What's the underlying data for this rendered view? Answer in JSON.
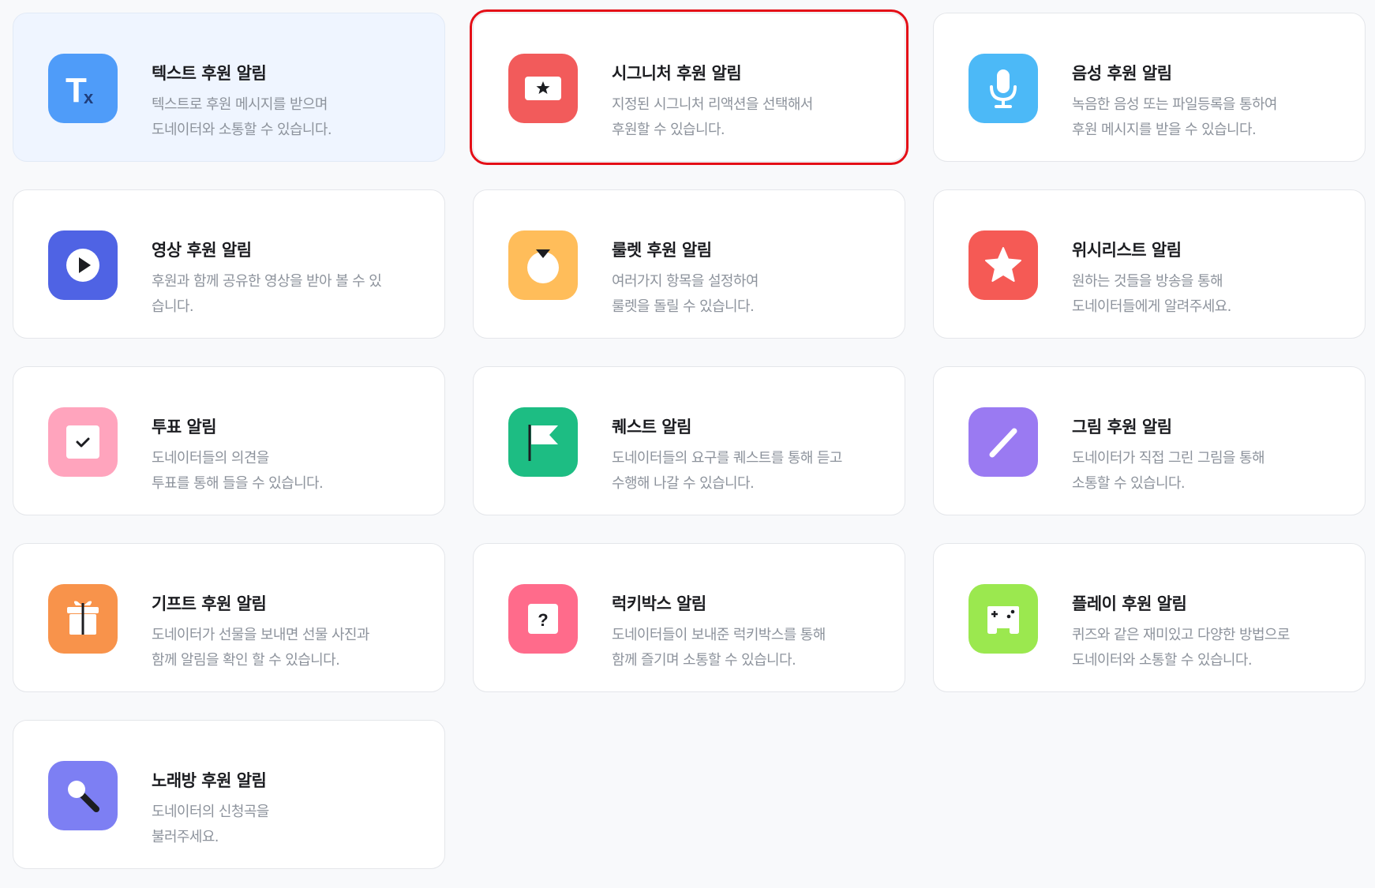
{
  "cards": [
    {
      "title": "텍스트 후원 알림",
      "desc1": "텍스트로 후원 메시지를 받으며",
      "desc2": "도네이터와 소통할 수 있습니다.",
      "icon": "text-icon",
      "color": "#4f9cf9",
      "active": true
    },
    {
      "title": "시그니처 후원 알림",
      "desc1": "지정된 시그니처 리액션을 선택해서",
      "desc2": "후원할 수 있습니다.",
      "icon": "signature-card-icon",
      "color": "#f25b5b",
      "highlighted": true
    },
    {
      "title": "음성 후원 알림",
      "desc1": "녹음한 음성 또는 파일등록을 통하여",
      "desc2": "후원 메시지를 받을 수 있습니다.",
      "icon": "microphone-icon",
      "color": "#4cb9f7"
    },
    {
      "title": "영상 후원 알림",
      "desc1": "후원과 함께 공유한 영상을 받아 볼 수 있",
      "desc2": "습니다.",
      "icon": "play-icon",
      "color": "#4f63e4"
    },
    {
      "title": "룰렛 후원 알림",
      "desc1": "여러가지 항목을 설정하여",
      "desc2": "룰렛을 돌릴 수 있습니다.",
      "icon": "roulette-icon",
      "color": "#ffbd5a"
    },
    {
      "title": "위시리스트 알림",
      "desc1": "원하는 것들을 방송을 통해",
      "desc2": "도네이터들에게 알려주세요.",
      "icon": "star-icon",
      "color": "#f55a55"
    },
    {
      "title": "투표 알림",
      "desc1": "도네이터들의 의견을",
      "desc2": "투표를 통해 들을 수 있습니다.",
      "icon": "checkbox-icon",
      "color": "#ffa4bd"
    },
    {
      "title": "퀘스트 알림",
      "desc1": "도네이터들의 요구를 퀘스트를 통해 듣고",
      "desc2": "수행해 나갈 수 있습니다.",
      "icon": "flag-icon",
      "color": "#1dbd83"
    },
    {
      "title": "그림 후원 알림",
      "desc1": "도네이터가 직접 그린 그림을 통해",
      "desc2": "소통할 수 있습니다.",
      "icon": "pencil-icon",
      "color": "#9a7af2"
    },
    {
      "title": "기프트 후원 알림",
      "desc1": "도네이터가 선물을 보내면 선물 사진과",
      "desc2": "함께 알림을 확인 할 수 있습니다.",
      "icon": "gift-icon",
      "color": "#f8934b"
    },
    {
      "title": "럭키박스 알림",
      "desc1": "도네이터들이 보내준 럭키박스를 통해",
      "desc2": "함께 즐기며 소통할 수 있습니다.",
      "icon": "question-box-icon",
      "color": "#ff6b8b"
    },
    {
      "title": "플레이 후원 알림",
      "desc1": "퀴즈와 같은 재미있고 다양한 방법으로",
      "desc2": "도네이터와 소통할 수 있습니다.",
      "icon": "gamepad-icon",
      "color": "#9be84f"
    },
    {
      "title": "노래방 후원 알림",
      "desc1": "도네이터의 신청곡을",
      "desc2": "불러주세요.",
      "icon": "karaoke-mic-icon",
      "color": "#7d7ff3"
    }
  ]
}
